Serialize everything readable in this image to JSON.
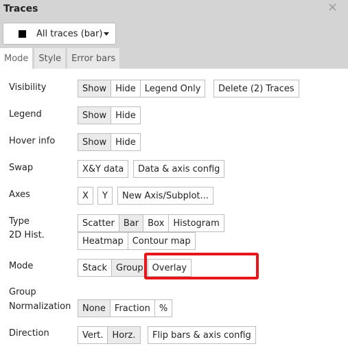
{
  "panel": {
    "title": "Traces",
    "close_icon": "close-icon"
  },
  "trace_selector": {
    "selected": "All traces (bar)",
    "swatch_color": "#000000"
  },
  "tabs": [
    {
      "label": "Mode",
      "active": true
    },
    {
      "label": "Style",
      "active": false
    },
    {
      "label": "Error bars",
      "active": false
    }
  ],
  "rows": {
    "visibility": {
      "label": "Visibility",
      "options": [
        "Show",
        "Hide",
        "Legend Only"
      ],
      "selected": "Show",
      "action": "Delete (2) Traces"
    },
    "legend": {
      "label": "Legend",
      "options": [
        "Show",
        "Hide"
      ],
      "selected": "Show"
    },
    "hover_info": {
      "label": "Hover info",
      "options": [
        "Show",
        "Hide"
      ],
      "selected": "Show"
    },
    "swap": {
      "label": "Swap",
      "actions": [
        "X&Y data",
        "Data & axis config"
      ]
    },
    "axes": {
      "label": "Axes",
      "actions": [
        "X",
        "Y",
        "New Axis/Subplot..."
      ]
    },
    "type": {
      "label": "Type",
      "label2": "2D Hist.",
      "options": [
        "Scatter",
        "Bar",
        "Box",
        "Histogram"
      ],
      "options2": [
        "Heatmap",
        "Contour map"
      ],
      "selected": "Bar"
    },
    "mode": {
      "label": "Mode",
      "options": [
        "Stack",
        "Group",
        "Overlay"
      ],
      "selected": "Group"
    },
    "group_normalization": {
      "label": "Group",
      "label2": "Normalization",
      "options": [
        "None",
        "Fraction",
        "%"
      ],
      "selected": "None"
    },
    "direction": {
      "label": "Direction",
      "options": [
        "Vert.",
        "Horz."
      ],
      "selected": "Horz.",
      "action": "Flip bars & axis config"
    }
  },
  "colors": {
    "header_bg": "#d4d4d4",
    "highlight": "#e8161b",
    "active_btn": "#ebebeb"
  }
}
